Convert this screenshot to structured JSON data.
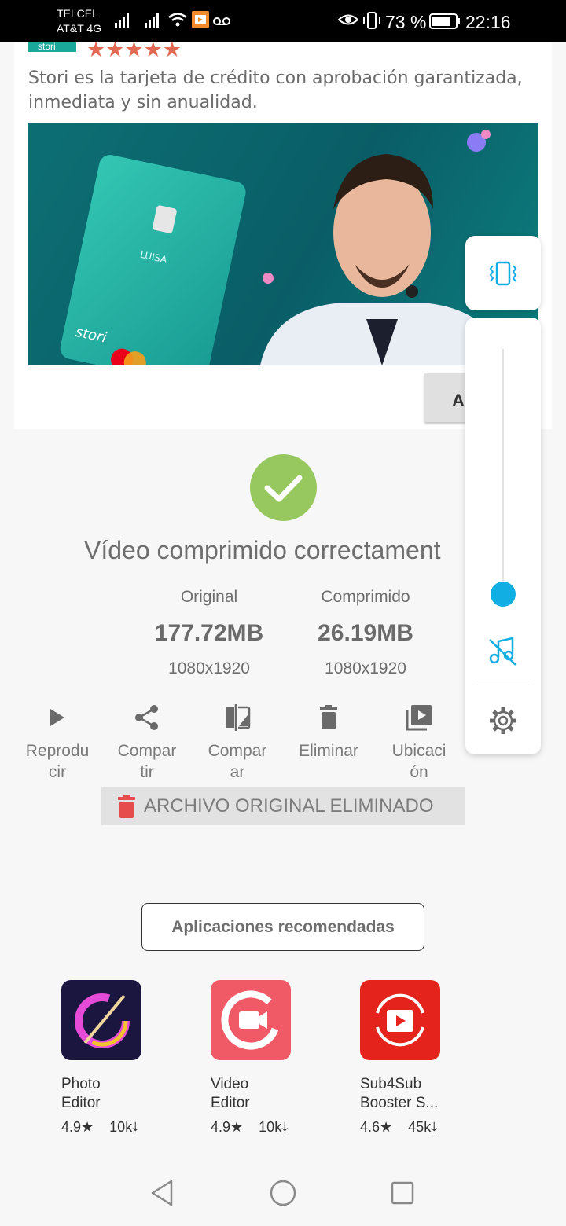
{
  "status_bar": {
    "carrier_1": "TELCEL",
    "carrier_2": "AT&T 4G",
    "battery": "73 %",
    "time": "22:16"
  },
  "ad": {
    "badge": "stori",
    "rating_stars": "★★★★★",
    "description": "Stori es la tarjeta de crédito con aprobación garantizada, inmediata y sin anualidad.",
    "card_name": "LUISA",
    "card_brand": "stori",
    "button_label": "A"
  },
  "result": {
    "title": "Vídeo comprimido correctament",
    "original": {
      "label": "Original",
      "size": "177.72MB",
      "resolution": "1080x1920"
    },
    "compressed": {
      "label": "Comprimido",
      "size": "26.19MB",
      "resolution": "1080x1920"
    }
  },
  "actions": [
    {
      "line1": "Reprodu",
      "line2": "cir",
      "icon": "play-icon"
    },
    {
      "line1": "Compar",
      "line2": "tir",
      "icon": "share-icon"
    },
    {
      "line1": "Compar",
      "line2": "ar",
      "icon": "compare-icon"
    },
    {
      "line1": "Eliminar",
      "line2": "",
      "icon": "trash-icon"
    },
    {
      "line1": "Ubicaci",
      "line2": "ón",
      "icon": "video-library-icon"
    }
  ],
  "deleted_banner": "ARCHIVO ORIGINAL ELIMINADO",
  "recommended_button": "Aplicaciones recomendadas",
  "apps": [
    {
      "name_1": "Photo",
      "name_2": "Editor",
      "rating": "4.9★",
      "downloads": "10k⤓"
    },
    {
      "name_1": "Video",
      "name_2": "Editor",
      "rating": "4.9★",
      "downloads": "10k⤓"
    },
    {
      "name_1": "Sub4Sub",
      "name_2": "Booster S...",
      "rating": "4.6★",
      "downloads": "45k⤓"
    }
  ],
  "volume_panel": {
    "level_percent": 2,
    "accent_color": "#11aee4"
  },
  "colors": {
    "success": "#97c860",
    "delete_red": "#e74c4c",
    "accent": "#11aee4"
  }
}
